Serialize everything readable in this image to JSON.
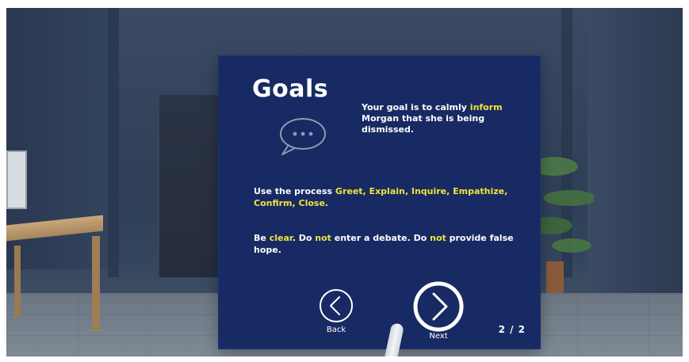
{
  "panel": {
    "title": "Goals",
    "icon": "chat-bubble-icon",
    "goal": {
      "prefix": "Your goal is to calmly ",
      "highlight": "inform",
      "suffix": " Morgan that she is being dismissed."
    },
    "process": {
      "prefix": "Use the process ",
      "steps": "Greet, Explain, Inquire, Empathize, Confirm, Close."
    },
    "rules": {
      "part1": "Be ",
      "hl1": "clear",
      "part2": ". Do ",
      "hl2": "not",
      "part3": " enter a debate. Do ",
      "hl3": "not",
      "part4": " provide false hope."
    },
    "back_label": "Back",
    "next_label": "Next",
    "page_indicator": "2 / 2"
  },
  "colors": {
    "panel_bg": "#172a63",
    "text": "#ffffff",
    "highlight": "#f1e33a"
  }
}
